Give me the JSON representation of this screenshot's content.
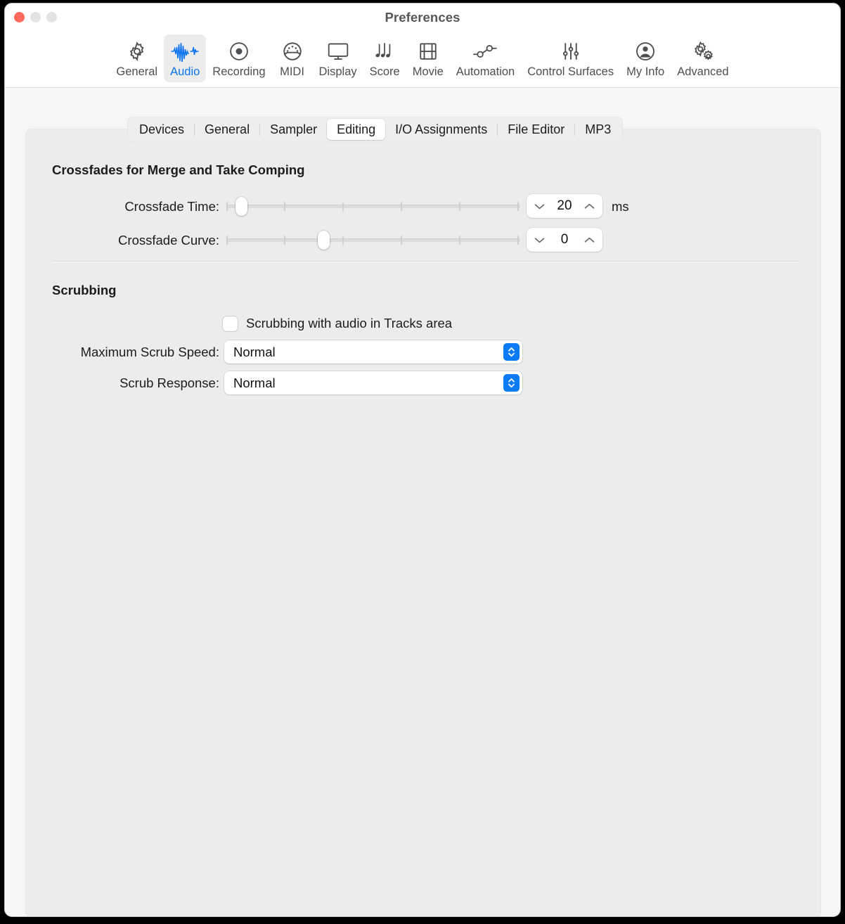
{
  "window": {
    "title": "Preferences",
    "traffic_lights": [
      "close-button",
      "minimize-button",
      "zoom-button"
    ]
  },
  "toolbar": {
    "items": [
      {
        "label": "General",
        "icon": "gear-icon",
        "selected": false
      },
      {
        "label": "Audio",
        "icon": "waveform-icon",
        "selected": true
      },
      {
        "label": "Recording",
        "icon": "record-circle-icon",
        "selected": false
      },
      {
        "label": "MIDI",
        "icon": "midi-plug-icon",
        "selected": false
      },
      {
        "label": "Display",
        "icon": "monitor-icon",
        "selected": false
      },
      {
        "label": "Score",
        "icon": "music-notes-icon",
        "selected": false
      },
      {
        "label": "Movie",
        "icon": "film-strip-icon",
        "selected": false
      },
      {
        "label": "Automation",
        "icon": "automation-node-icon",
        "selected": false
      },
      {
        "label": "Control Surfaces",
        "icon": "sliders-icon",
        "selected": false
      },
      {
        "label": "My Info",
        "icon": "person-circle-icon",
        "selected": false
      },
      {
        "label": "Advanced",
        "icon": "double-gear-icon",
        "selected": false
      }
    ],
    "accent_color": "#0a74f0"
  },
  "tabs": {
    "items": [
      {
        "label": "Devices",
        "active": false
      },
      {
        "label": "General",
        "active": false
      },
      {
        "label": "Sampler",
        "active": false
      },
      {
        "label": "Editing",
        "active": true
      },
      {
        "label": "I/O Assignments",
        "active": false
      },
      {
        "label": "File Editor",
        "active": false
      },
      {
        "label": "MP3",
        "active": false
      }
    ]
  },
  "content": {
    "crossfades": {
      "title": "Crossfades for Merge and Take Comping",
      "crossfade_time": {
        "label": "Crossfade Time:",
        "value": "20",
        "unit": "ms",
        "slider_position_pct": 4,
        "tick_count": 6
      },
      "crossfade_curve": {
        "label": "Crossfade Curve:",
        "value": "0",
        "unit": "",
        "slider_position_pct": 33,
        "tick_count": 6
      }
    },
    "scrubbing": {
      "title": "Scrubbing",
      "checkbox": {
        "label": "Scrubbing with audio in Tracks area",
        "checked": false
      },
      "max_scrub_speed": {
        "label": "Maximum Scrub Speed:",
        "value": "Normal"
      },
      "scrub_response": {
        "label": "Scrub Response:",
        "value": "Normal"
      }
    }
  }
}
